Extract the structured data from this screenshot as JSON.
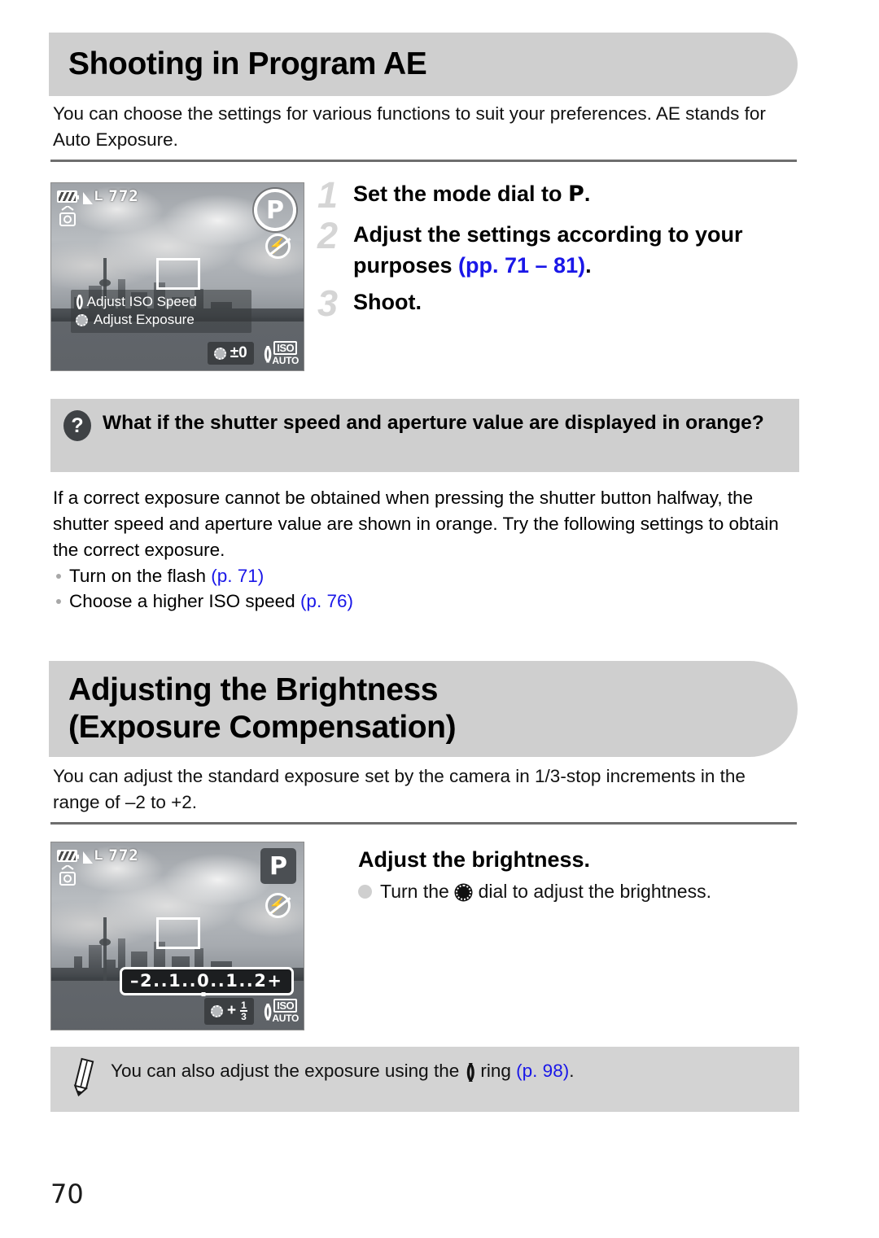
{
  "page_number": "70",
  "sections": [
    {
      "id": "program-ae",
      "header": "Shooting in Program AE",
      "intro": "You can choose the settings for various functions to suit your preferences. AE stands for Auto Exposure.",
      "steps": [
        {
          "num": "1",
          "text_before": "Set the mode dial to ",
          "glyph": "P",
          "text_after": ".",
          "link": ""
        },
        {
          "num": "2",
          "text_before": "Adjust the settings according to your purposes ",
          "link": "(pp. 71 – 81)",
          "text_after": "."
        },
        {
          "num": "3",
          "text_before": "Shoot.",
          "link": "",
          "text_after": ""
        }
      ]
    },
    {
      "id": "brightness",
      "header_line1": "Adjusting the Brightness",
      "header_line2": "(Exposure Compensation)",
      "intro": "You can adjust the standard exposure set by the camera in 1/3-stop increments in the range of –2 to +2.",
      "step_heading": "Adjust the brightness.",
      "step_sub_before": "Turn the ",
      "step_sub_after": " dial to adjust the brightness."
    }
  ],
  "qa": {
    "icon": "question-mark",
    "question": "What if the shutter speed and aperture value are displayed in orange?",
    "answer": "If a correct exposure cannot be obtained when pressing the shutter button halfway, the shutter speed and aperture value are shown in orange. Try the following settings to obtain the correct exposure.",
    "bullets": [
      {
        "text": "Turn on the flash ",
        "link": "(p. 71)"
      },
      {
        "text": "Choose a higher ISO speed ",
        "link": "(p. 76)"
      }
    ]
  },
  "note": {
    "icon": "pencil-icon",
    "text_before": "You can also adjust the exposure using the ",
    "text_middle": " ring ",
    "link": "(p. 98)",
    "text_after": "."
  },
  "lcd_program": {
    "battery": "battery-full-icon",
    "quality": "L",
    "shots_remaining": "772",
    "stabilizer": "image-stabilizer-icon",
    "mode": "P",
    "flash": "flash-off-icon",
    "guide": [
      {
        "icon": "ring-icon",
        "label": "Adjust ISO Speed"
      },
      {
        "icon": "dial-icon",
        "label": "Adjust Exposure"
      }
    ],
    "exposure_value": "±0",
    "iso_label": "ISO",
    "iso_value": "AUTO"
  },
  "lcd_brightness": {
    "battery": "battery-full-icon",
    "quality": "L",
    "shots_remaining": "772",
    "stabilizer": "image-stabilizer-icon",
    "mode": "P",
    "flash": "flash-off-icon",
    "exposure_scale_left": "–2..1..",
    "exposure_scale_zero": "0",
    "exposure_scale_right": "..1..2+",
    "exposure_comp_sign": "+",
    "exposure_comp_num": "1",
    "exposure_comp_den": "3",
    "iso_label": "ISO",
    "iso_value": "AUTO"
  },
  "colors": {
    "header_bar": "#cfcfcf",
    "link": "#1a17e8",
    "rule": "#6e6e6e",
    "step_number": "#d5d5d5",
    "note_box": "#d3d3d3"
  }
}
